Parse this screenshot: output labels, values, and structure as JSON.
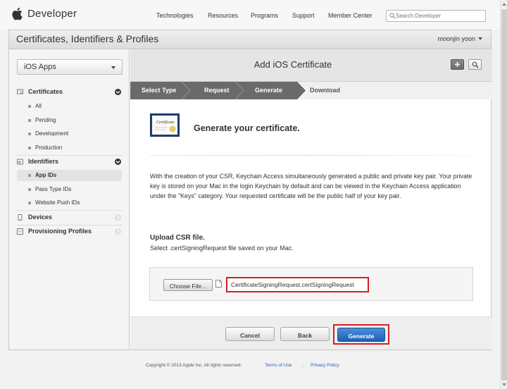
{
  "topnav": {
    "brand": "Developer",
    "links": [
      "Technologies",
      "Resources",
      "Programs",
      "Support",
      "Member Center"
    ],
    "search_placeholder": "Search Developer"
  },
  "header": {
    "title": "Certificates, Identifiers & Profiles",
    "user": "moonjin yoon"
  },
  "sidebar": {
    "platform": "iOS Apps",
    "sections": [
      {
        "label": "Certificates",
        "icon": "certificate-icon",
        "items": [
          "All",
          "Pending",
          "Development",
          "Production"
        ]
      },
      {
        "label": "Identifiers",
        "icon": "id-icon",
        "items": [
          "App IDs",
          "Pass Type IDs",
          "Website Push IDs"
        ],
        "selected": "App IDs"
      },
      {
        "label": "Devices",
        "icon": "device-icon",
        "items": []
      },
      {
        "label": "Provisioning Profiles",
        "icon": "profile-icon",
        "items": []
      }
    ]
  },
  "content": {
    "title": "Add iOS Certificate",
    "steps": [
      "Select Type",
      "Request",
      "Generate",
      "Download"
    ],
    "heading": "Generate your certificate.",
    "certificate_label": "Certificate",
    "paragraph": "With the creation of your CSR, Keychain Access simultaneously generated a public and private key pair. Your private key is stored on your Mac in the login Keychain by default and can be viewed in the Keychain Access application under the \"Keys\" category. Your requested certificate will be the public half of your key pair.",
    "upload_label": "Upload CSR file.",
    "upload_sub": "Select .certSigningRequest file saved on your Mac.",
    "choose_file": "Choose File...",
    "file_name": "CertificateSigningRequest.certSigningRequest",
    "buttons": {
      "cancel": "Cancel",
      "back": "Back",
      "generate": "Generate"
    }
  },
  "footer": {
    "copyright": "Copyright © 2013 Apple Inc. All rights reserved.",
    "terms": "Terms of Use",
    "privacy": "Privacy Policy",
    "separator": "|"
  },
  "colors": {
    "accent": "#1e5fb8",
    "highlight": "#d61f26",
    "step_active": "#6a6a6a"
  }
}
